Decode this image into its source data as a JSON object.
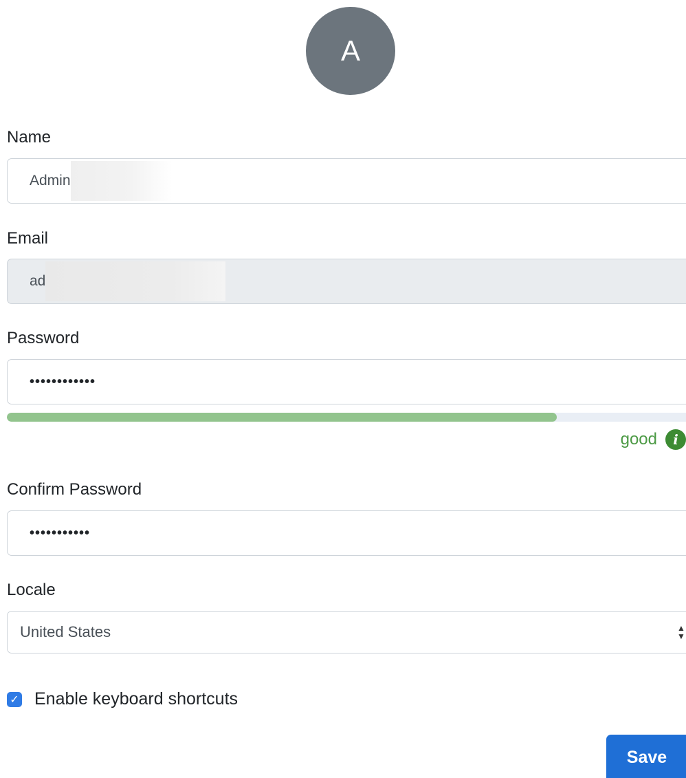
{
  "avatar": {
    "initial": "A",
    "color": "#6c757d"
  },
  "fields": {
    "name": {
      "label": "Name",
      "value": "Admin"
    },
    "email": {
      "label": "Email",
      "value": "ad"
    },
    "password": {
      "label": "Password",
      "value": "••••••••••••"
    },
    "confirm_password": {
      "label": "Confirm Password",
      "value": "•••••••••••"
    },
    "locale": {
      "label": "Locale",
      "value": "United States"
    }
  },
  "password_strength": {
    "label": "good",
    "fraction": 0.81,
    "color": "#92c48d",
    "icon": "info-icon"
  },
  "keyboard_shortcuts": {
    "label": "Enable keyboard shortcuts",
    "checked": true,
    "icon": "check-icon"
  },
  "save_button": {
    "label": "Save",
    "color": "#1f6fd6"
  }
}
